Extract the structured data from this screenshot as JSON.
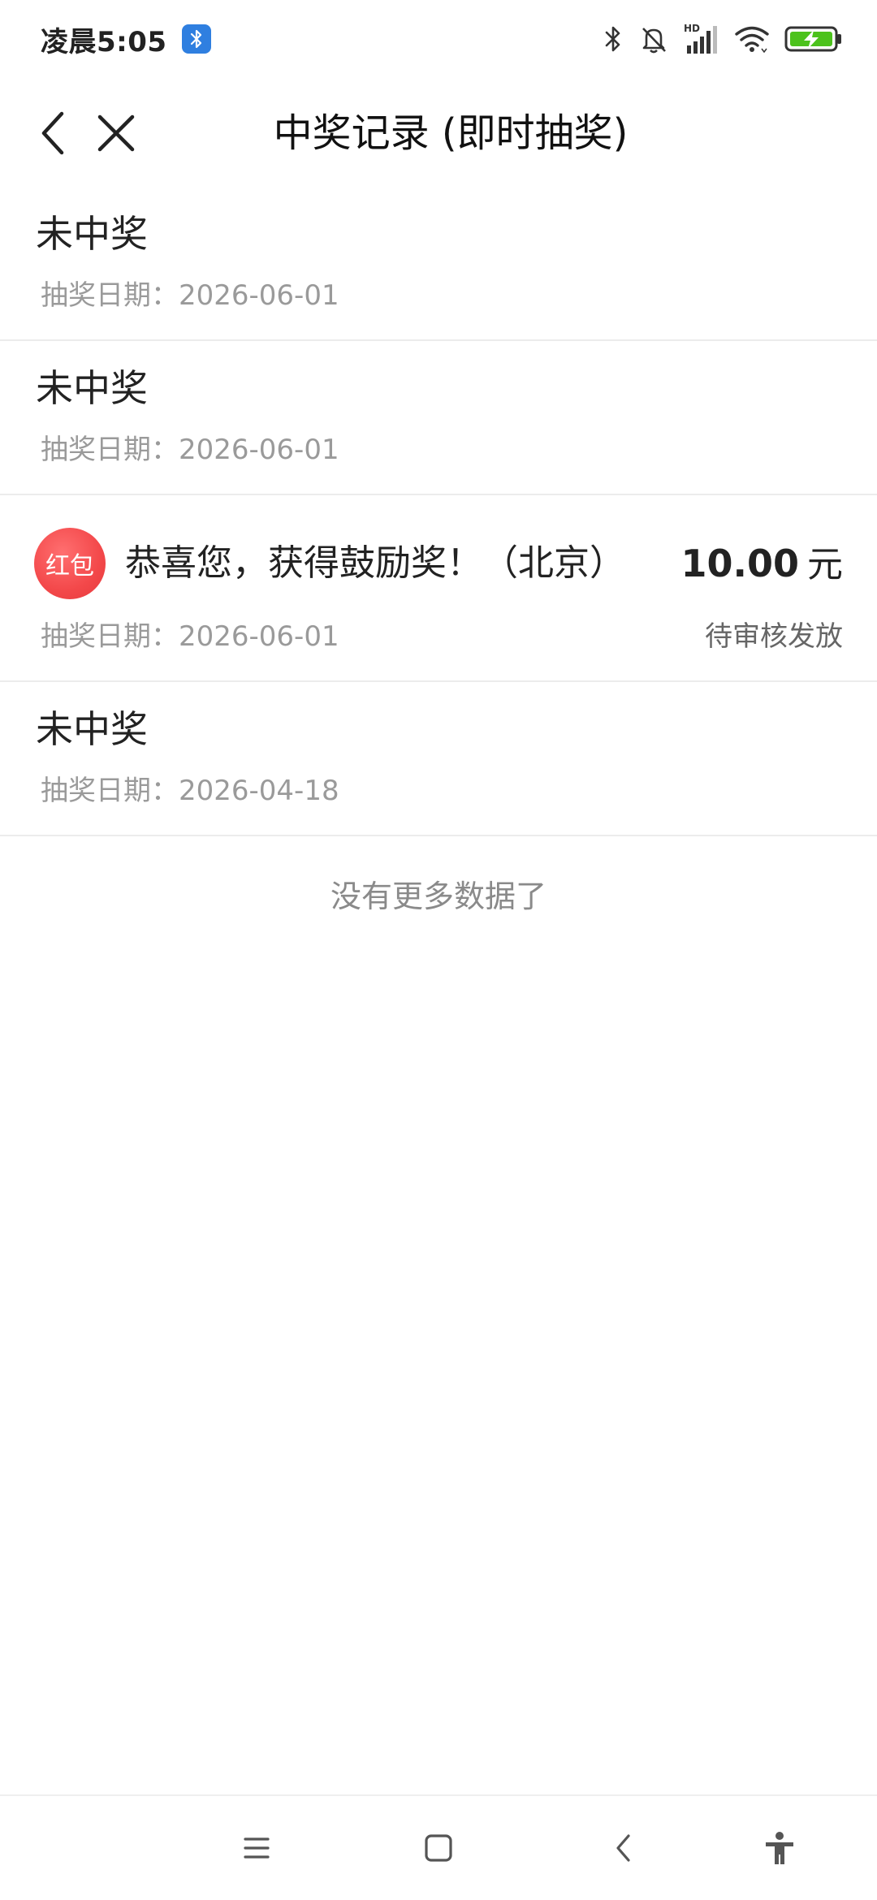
{
  "status_bar": {
    "time": "凌晨5:05",
    "icons": [
      "bluetooth-app-badge",
      "bluetooth-icon",
      "mute-bell-icon",
      "hd-signal-icon",
      "wifi-icon",
      "battery-charging-icon"
    ],
    "hd_label": "HD"
  },
  "nav": {
    "title": "中奖记录 (即时抽奖)",
    "back_icon": "chevron-left-icon",
    "close_icon": "close-icon"
  },
  "records": [
    {
      "title": "未中奖",
      "date_label": "抽奖日期：",
      "date": "2026-06-01"
    },
    {
      "title": "未中奖",
      "date_label": "抽奖日期：",
      "date": "2026-06-01"
    },
    {
      "badge": "红包",
      "title": "恭喜您，获得鼓励奖！（北京）",
      "amount": "10.00",
      "unit": "元",
      "date_label": "抽奖日期：",
      "date": "2026-06-01",
      "status": "待审核发放"
    },
    {
      "title": "未中奖",
      "date_label": "抽奖日期：",
      "date": "2026-04-18"
    }
  ],
  "no_more_text": "没有更多数据了",
  "system_nav": {
    "buttons": [
      "menu-icon",
      "home-icon",
      "back-icon",
      "accessibility-icon"
    ]
  },
  "colors": {
    "badge_red": "#f3484a",
    "bt_badge_blue": "#2f7fe0",
    "battery_green": "#4cc21c"
  }
}
